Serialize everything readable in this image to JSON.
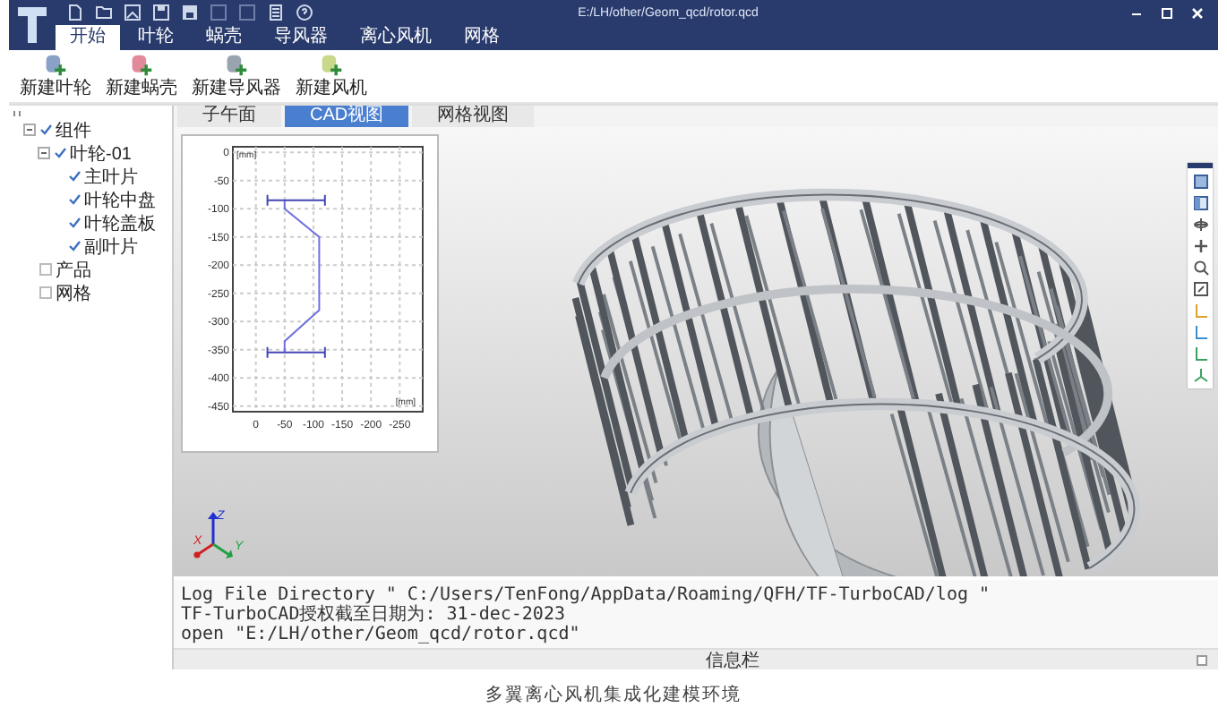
{
  "window": {
    "title": "E:/LH/other/Geom_qcd/rotor.qcd"
  },
  "ribbon_tabs": [
    {
      "label": "开始",
      "selected": true
    },
    {
      "label": "叶轮",
      "selected": false
    },
    {
      "label": "蜗壳",
      "selected": false
    },
    {
      "label": "导风器",
      "selected": false
    },
    {
      "label": "离心风机",
      "selected": false
    },
    {
      "label": "网格",
      "selected": false
    }
  ],
  "toolbar": [
    {
      "label": "新建叶轮",
      "kind": "impeller"
    },
    {
      "label": "新建蜗壳",
      "kind": "volute"
    },
    {
      "label": "新建导风器",
      "kind": "guide"
    },
    {
      "label": "新建风机",
      "kind": "fan"
    }
  ],
  "tree": [
    {
      "label": "组件",
      "checked": true,
      "expanded": true,
      "children": [
        {
          "label": "叶轮-01",
          "checked": true,
          "expanded": true,
          "children": [
            {
              "label": "主叶片",
              "checked": true
            },
            {
              "label": "叶轮中盘",
              "checked": true
            },
            {
              "label": "叶轮盖板",
              "checked": true
            },
            {
              "label": "副叶片",
              "checked": true
            }
          ]
        }
      ]
    },
    {
      "label": "产品",
      "checked": false
    },
    {
      "label": "网格",
      "checked": false
    }
  ],
  "view_tabs": [
    {
      "label": "子午面",
      "selected": false
    },
    {
      "label": "CAD视图",
      "selected": true
    },
    {
      "label": "网格视图",
      "selected": false
    }
  ],
  "chart_data": {
    "type": "line",
    "grid": true,
    "xlabel": "[mm]",
    "ylabel": "[mm]",
    "xlim": [
      40,
      -290
    ],
    "ylim": [
      -460,
      10
    ],
    "xticks": [
      0,
      -50,
      -100,
      -150,
      -200,
      -250
    ],
    "yticks": [
      0,
      -50,
      -100,
      -150,
      -200,
      -250,
      -300,
      -350,
      -400,
      -450
    ],
    "series": [
      {
        "color": "#6f6fe0",
        "x": [
          -50,
          -50,
          -110,
          -110,
          -50,
          -50
        ],
        "values": [
          -85,
          -100,
          -150,
          -280,
          -335,
          -355
        ]
      },
      {
        "color": "#4545b5",
        "x": [
          -20,
          -120
        ],
        "values": [
          -85,
          -85
        ]
      },
      {
        "color": "#4545b5",
        "x": [
          -20,
          -120
        ],
        "values": [
          -355,
          -355
        ]
      }
    ]
  },
  "viewport": {
    "axis_labels": [
      "Z",
      "X",
      "Y"
    ]
  },
  "log": {
    "lines": [
      "Log File Directory \" C:/Users/TenFong/AppData/Roaming/QFH/TF-TurboCAD/log \"",
      "TF-TurboCAD授权截至日期为: 31-dec-2023",
      "open \"E:/LH/other/Geom_qcd/rotor.qcd\""
    ]
  },
  "status_bar": "信息栏",
  "caption": "多翼离心风机集成化建模环境"
}
